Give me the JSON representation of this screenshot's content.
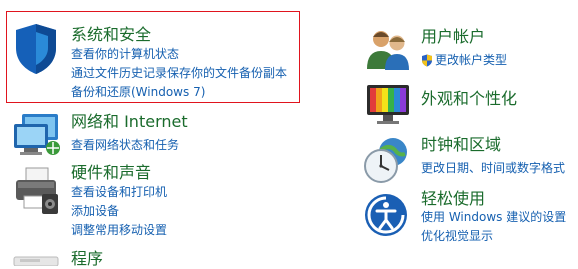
{
  "categories": [
    {
      "title": "系统和安全",
      "links": [
        "查看你的计算机状态",
        "通过文件历史记录保存你的文件备份副本",
        "备份和还原(Windows 7)"
      ],
      "icon": "shield-icon"
    },
    {
      "title": "网络和 Internet",
      "links": [
        "查看网络状态和任务"
      ],
      "icon": "network-icon"
    },
    {
      "title": "硬件和声音",
      "links": [
        "查看设备和打印机",
        "添加设备",
        "调整常用移动设置"
      ],
      "icon": "printer-icon"
    },
    {
      "title": "程序",
      "links": [],
      "icon": "programs-icon"
    },
    {
      "title": "用户帐户",
      "links": [
        "更改帐户类型"
      ],
      "icon": "users-icon"
    },
    {
      "title": "外观和个性化",
      "links": [],
      "icon": "appearance-icon"
    },
    {
      "title": "时钟和区域",
      "links": [
        "更改日期、时间或数字格式"
      ],
      "icon": "clock-icon"
    },
    {
      "title": "轻松使用",
      "links": [
        "使用 Windows 建议的设置",
        "优化视觉显示"
      ],
      "icon": "ease-of-access-icon"
    }
  ],
  "colors": {
    "title": "#1a6b2c",
    "link": "#1660b0",
    "selection_border": "#e0141e"
  }
}
